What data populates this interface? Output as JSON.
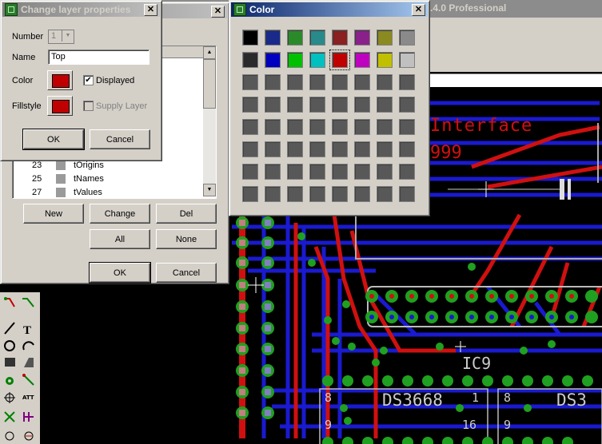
{
  "app_title_fragment": ".4.0 Professional",
  "change_layer_dialog": {
    "title": "Change layer properties",
    "number_label": "Number",
    "number_value": "1",
    "name_label": "Name",
    "name_value": "Top",
    "color_label": "Color",
    "displayed_label": "Displayed",
    "displayed_checked": true,
    "fillstyle_label": "Fillstyle",
    "supply_layer_label": "Supply Layer",
    "supply_layer_checked": false,
    "layer_color": "#c00000",
    "ok_label": "OK",
    "cancel_label": "Cancel"
  },
  "layers_dialog": {
    "rows": [
      {
        "num": "23",
        "name": "tOrigins"
      },
      {
        "num": "25",
        "name": "tNames"
      },
      {
        "num": "27",
        "name": "tValues"
      }
    ],
    "new_label": "New",
    "change_label": "Change",
    "del_label": "Del",
    "all_label": "All",
    "none_label": "None",
    "ok_label": "OK",
    "cancel_label": "Cancel"
  },
  "color_dialog": {
    "title": "Color",
    "row1": [
      "#000000",
      "#1a2a8a",
      "#2a8a2a",
      "#288a8a",
      "#8a2020",
      "#8a208a",
      "#8a8a20",
      "#8a8a8a"
    ],
    "row2": [
      "#2a2a2a",
      "#0000c0",
      "#00c000",
      "#00c0c0",
      "#c00000",
      "#c000c0",
      "#c0c000",
      "#c0c0c0"
    ],
    "empty_color": "#585858",
    "selected": "#c00000"
  },
  "pcb": {
    "text_interface": "Interface",
    "text_999": "999",
    "label_ic9": "IC9",
    "label_ds3668_a": "DS3668",
    "label_ds3668_b": "DS3",
    "pin_8a": "8",
    "pin_1a": "1",
    "pin_9a": "9",
    "pin_16a": "16",
    "pin_8b": "8",
    "pin_9b": "9"
  },
  "toolbar_icons": [
    "route-icon",
    "ripup-icon",
    "wire-icon",
    "text-icon",
    "circle-icon",
    "arc-icon",
    "rect-icon",
    "polygon-icon",
    "via-icon",
    "signal-icon",
    "hole-icon",
    "attribute-icon",
    "ratsnest-icon",
    "auto-icon",
    "drc-icon",
    "errors-icon"
  ]
}
